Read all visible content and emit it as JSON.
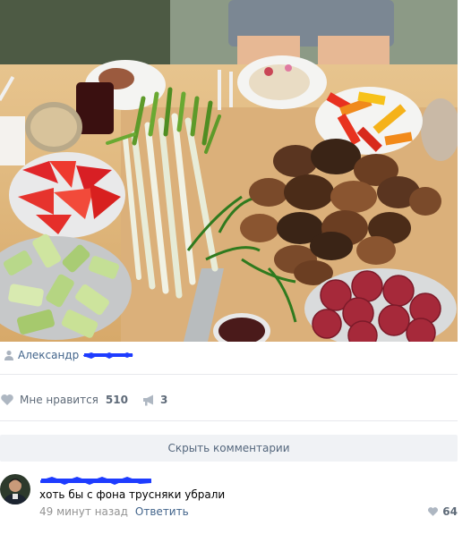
{
  "post": {
    "photo": {
      "icon": "photo-of-grilled-meat-and-vegetables"
    },
    "author": {
      "name": "Александр"
    },
    "likes": {
      "label": "Мне нравится",
      "count": "510"
    },
    "shares": {
      "count": "3"
    }
  },
  "comments_toggle": {
    "label": "Скрыть комментарии"
  },
  "comment": {
    "text": "хоть бы с фона трусняки убрали",
    "time": "49 минут назад",
    "reply_label": "Ответить",
    "likes": "64"
  },
  "colors": {
    "link": "#42648b",
    "muted": "#939393",
    "counter": "#5e6a78",
    "scribble": "#1e3cff",
    "button_bg": "#f0f2f5"
  },
  "icons": {
    "author": "person-icon",
    "like": "heart-icon",
    "share": "megaphone-icon",
    "comment_like": "heart-icon"
  }
}
